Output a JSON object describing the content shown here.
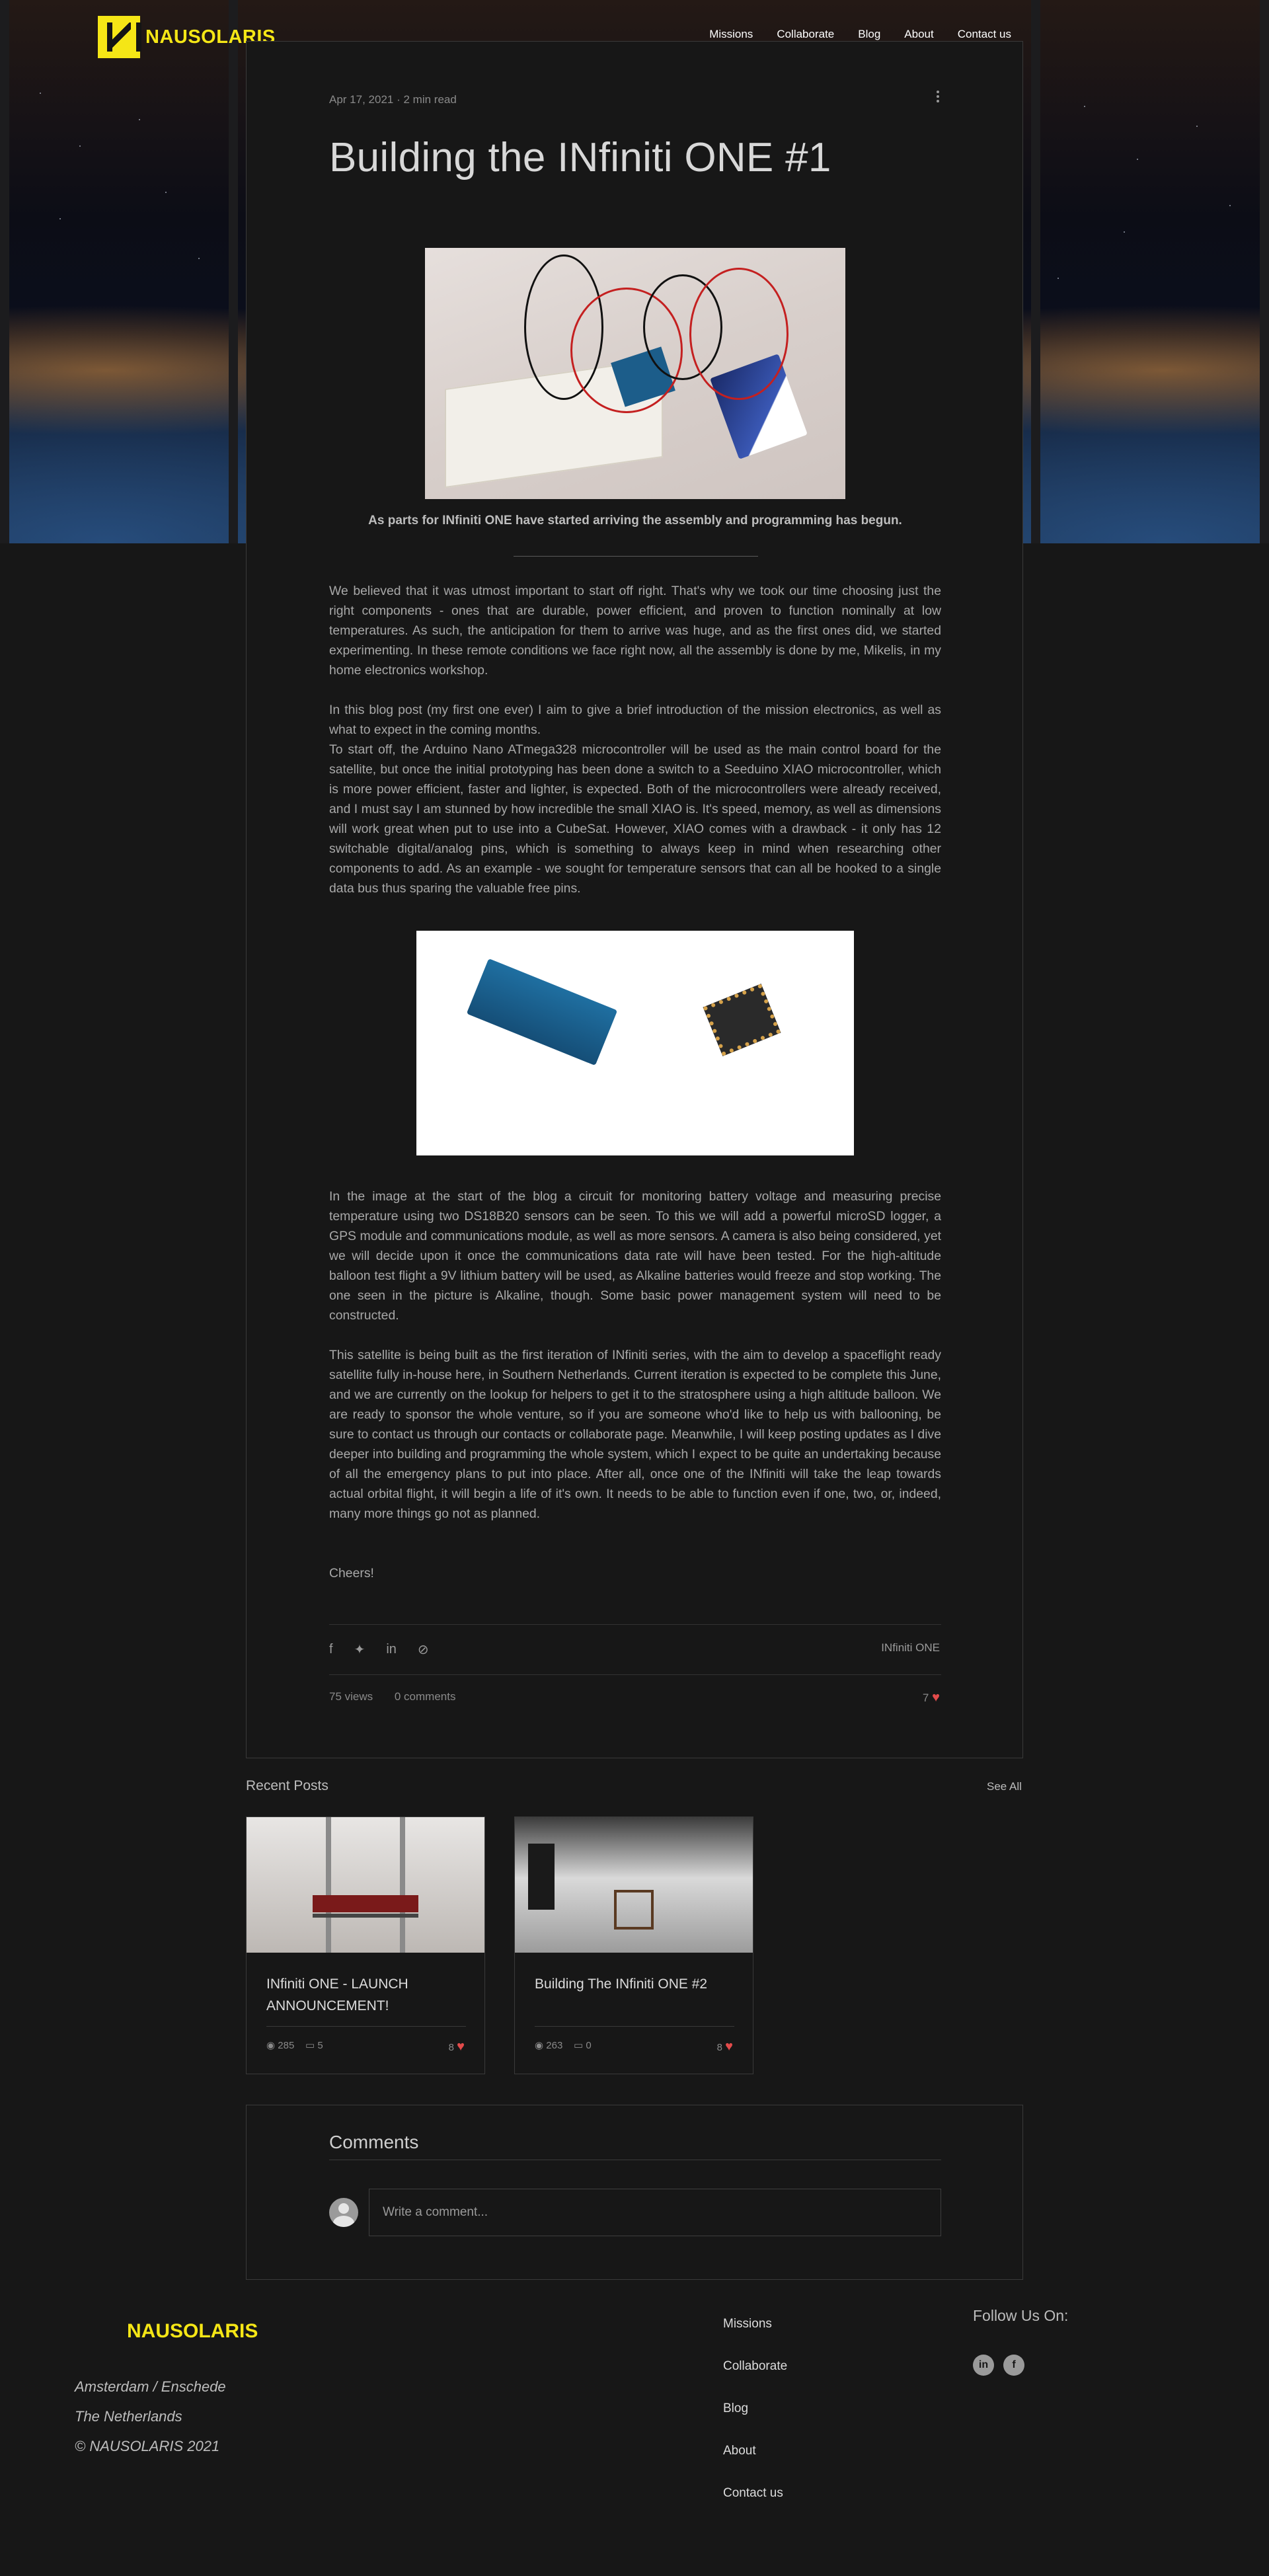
{
  "brand": {
    "name": "NAUSOLARIS",
    "accent": "#f5e616"
  },
  "nav": [
    "Missions",
    "Collaborate",
    "Blog",
    "About",
    "Contact us"
  ],
  "post": {
    "date": "Apr 17, 2021",
    "read_time": "2 min read",
    "title": "Building the INfiniti ONE #1",
    "caption": "As parts for INfiniti ONE have started arriving the assembly and programming has begun.",
    "paragraphs": [
      "We believed that it was utmost important to start off right. That's why we took our time choosing just the right components - ones that are durable, power efficient, and proven to function nominally at low temperatures. As such, the anticipation for them to arrive was huge, and as the first ones did, we started experimenting. In these remote conditions we face right now, all the assembly is done by me, Mikelis, in my home electronics workshop.",
      "In this blog post (my first one ever) I aim to give a brief introduction of the mission electronics, as well as what to expect in the coming months.",
      "To start off, the Arduino Nano ATmega328 microcontroller will be used as the main control board for the satellite, but once the initial prototyping has been done a switch to a Seeduino XIAO microcontroller, which is more power efficient, faster and lighter, is expected. Both of the microcontrollers were already received, and I must say I am stunned by how incredible the small XIAO is. It's speed, memory, as well as dimensions will work great when put to use into a CubeSat. However, XIAO comes with a drawback - it only has 12 switchable digital/analog pins, which is something to always keep in mind when researching other components to add. As an example - we sought for temperature sensors that can all be hooked to a single data bus thus sparing the valuable free pins.",
      "In the image at the start of the blog a circuit for monitoring battery voltage and measuring precise temperature using two DS18B20 sensors can be seen. To this we will add a powerful microSD logger, a GPS module and communications module, as well as more sensors. A camera is also being considered, yet we will decide upon it once the communications data rate will have been tested. For the high-altitude balloon test flight a 9V lithium battery will be used, as Alkaline batteries would freeze and stop working. The one seen in the picture is Alkaline, though. Some basic power management system will need to be constructed.",
      "This satellite is being built as the first iteration of INfiniti series, with the aim to develop a spaceflight ready satellite fully in-house here, in Southern Netherlands. Current iteration is expected to be complete this June, and we are currently on the lookup for helpers to get it to the stratosphere using a high altitude balloon. We are ready to sponsor the whole venture, so if you are someone who'd like to help us with ballooning, be sure to contact us through our contacts or collaborate page. Meanwhile, I will keep posting updates as I dive deeper into building and programming the whole system, which I expect to be quite an undertaking because of all the emergency plans to put into place. After all, once one of the INfiniti will take the leap towards actual orbital flight, it will begin a life of it's own. It needs to be able to function even if one, two, or, indeed, many more things go not as planned.",
      "Cheers!"
    ],
    "tag": "INfiniti ONE",
    "views": "75 views",
    "comments": "0 comments",
    "likes": "7"
  },
  "recent": {
    "heading": "Recent Posts",
    "see_all": "See All",
    "items": [
      {
        "title": "INfiniti ONE - LAUNCH ANNOUNCEMENT!",
        "views": "285",
        "comments": "5",
        "likes": "8"
      },
      {
        "title": "Building The INfiniti ONE #2",
        "views": "263",
        "comments": "0",
        "likes": "8"
      }
    ]
  },
  "comments": {
    "heading": "Comments",
    "placeholder": "Write a comment..."
  },
  "footer": {
    "brand": "NAUSOLARIS",
    "address": [
      "Amsterdam / Enschede",
      "The Netherlands",
      "© NAUSOLARIS 2021"
    ],
    "nav": [
      "Missions",
      "Collaborate",
      "Blog",
      "About",
      "Contact us"
    ],
    "follow": "Follow Us On:"
  },
  "icons": [
    "menu-dots-icon",
    "facebook-icon",
    "twitter-icon",
    "linkedin-icon",
    "link-icon",
    "heart-icon",
    "eye-icon",
    "comment-icon"
  ]
}
